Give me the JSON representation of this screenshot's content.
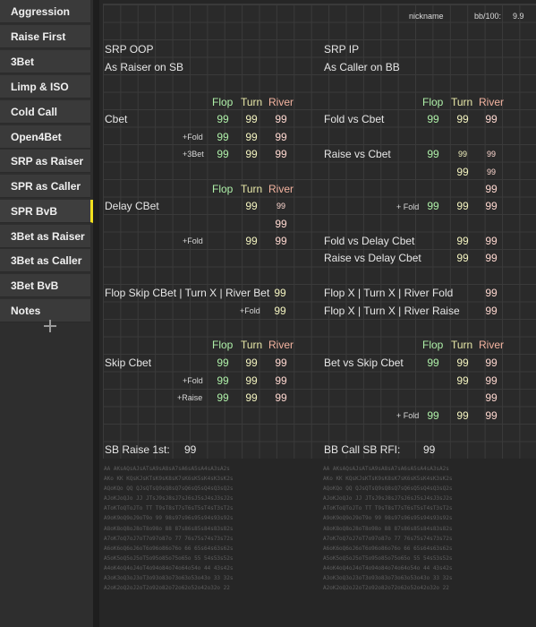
{
  "sidebar": {
    "items": [
      {
        "label": "Aggression"
      },
      {
        "label": "Raise First"
      },
      {
        "label": "3Bet"
      },
      {
        "label": "Limp & ISO"
      },
      {
        "label": "Cold Call"
      },
      {
        "label": "Open4Bet"
      },
      {
        "label": "SRP as Raiser"
      },
      {
        "label": "SPR as Caller"
      },
      {
        "label": "SPR BvB"
      },
      {
        "label": "3Bet as Raiser"
      },
      {
        "label": "3Bet as Caller"
      },
      {
        "label": "3Bet BvB"
      },
      {
        "label": "Notes"
      }
    ],
    "active_index": 8,
    "accent_color": "#f2e01e",
    "add_icon": "plus-icon"
  },
  "header": {
    "nickname_label": "nickname",
    "bb100_label": "bb/100:",
    "bb100_value": "9.9"
  },
  "left": {
    "title": "SRP OOP",
    "subtitle": "As Raiser on SB",
    "col_flop": "Flop",
    "col_turn": "Turn",
    "col_river": "River",
    "cbet": {
      "label": "Cbet",
      "flop": "99",
      "turn": "99",
      "river": "99"
    },
    "cbet_fold": {
      "label": "+Fold",
      "flop": "99",
      "turn": "99",
      "river": "99"
    },
    "cbet_3bet": {
      "label": "+3Bet",
      "flop": "99",
      "turn": "99",
      "river": "99"
    },
    "delay_cbet": {
      "label": "Delay CBet",
      "turn": "99",
      "river": "99",
      "river2": "99"
    },
    "delay_fold": {
      "label": "+Fold",
      "turn": "99",
      "river": "99"
    },
    "flop_skip": {
      "label": "Flop Skip CBet | Turn X | River Bet",
      "river": "99"
    },
    "flop_skip_fold": {
      "label": "+Fold",
      "river": "99"
    },
    "skip_cbet": {
      "label": "Skip Cbet",
      "flop": "99",
      "turn": "99",
      "river": "99"
    },
    "skip_fold": {
      "label": "+Fold",
      "flop": "99",
      "turn": "99",
      "river": "99"
    },
    "skip_raise": {
      "label": "+Raise",
      "flop": "99",
      "turn": "99",
      "river": "99"
    },
    "footer_label": "SB Raise 1st:",
    "footer_value": "99"
  },
  "right": {
    "title": "SRP IP",
    "subtitle": "As Caller on BB",
    "col_flop": "Flop",
    "col_turn": "Turn",
    "col_river": "River",
    "fold_vs_cbet": {
      "label": "Fold vs Cbet",
      "flop": "99",
      "turn": "99",
      "river": "99"
    },
    "raise_vs_cbet": {
      "label": "Raise vs Cbet",
      "flop": "99",
      "turn": "99",
      "river": "99",
      "turn2": "99",
      "river2": "99"
    },
    "delay_fold_row": {
      "river": "99"
    },
    "delay_plus_fold": {
      "label": "+ Fold",
      "flop": "99",
      "turn": "99",
      "river": "99"
    },
    "fold_vs_delay": {
      "label": "Fold vs Delay Cbet",
      "turn": "99",
      "river": "99"
    },
    "raise_vs_delay": {
      "label": "Raise vs Delay Cbet",
      "turn": "99",
      "river": "99"
    },
    "flop_x_fold": {
      "label": "Flop X | Turn X | River Fold",
      "river": "99"
    },
    "flop_x_raise": {
      "label": "Flop X | Turn X | River Raise",
      "river": "99"
    },
    "bet_vs_skip": {
      "label": "Bet vs Skip Cbet",
      "flop": "99",
      "turn": "99",
      "river": "99"
    },
    "bet_vs_skip_r2": {
      "turn": "99",
      "river": "99"
    },
    "bet_vs_skip_r3": {
      "river": "99"
    },
    "bet_plus_fold": {
      "label": "+ Fold",
      "flop": "99",
      "turn": "99",
      "river": "99"
    },
    "footer_label": "BB Call SB RFI:",
    "footer_value": "99"
  },
  "ranges": {
    "left": "AA AKsAQsAJsATsA9sA8sA7sA6sA5sA4sA3sA2s\nAKo KK KQsKJsKTsK9sK8sK7sK6sK5sK4sK3sK2s\nAQoKQo QQ QJsQTsQ9sQ8sQ7sQ6sQ5sQ4sQ3sQ2s\nAJoKJoQJo JJ JTsJ9sJ8sJ7sJ6sJ5sJ4sJ3sJ2s\nAToKToQToJTo TT T9sT8sT7sT6sT5sT4sT3sT2s\nA9oK9oQ9oJ9oT9o 99 98s97s96s95s94s93s92s\nA8oK8oQ8oJ8oT8o98o 88 87s86s85s84s83s82s\nA7oK7oQ7oJ7oT7o97o87o 77 76s75s74s73s72s\nA6oK6oQ6oJ6oT6o96o86o76o 66 65s64s63s62s\nA5oK5oQ5oJ5oT5o95o85o75o65o 55 54s53s52s\nA4oK4oQ4oJ4oT4o94o84o74o64o54o 44 43s42s\nA3oK3oQ3oJ3oT3o93o83o73o63o53o43o 33 32s\nA2oK2oQ2oJ2oT2o92o82o72o62o52o42o32o 22",
    "right": "AA AKsAQsAJsATsA9sA8sA7sA6sA5sA4sA3sA2s\nAKo KK KQsKJsKTsK9sK8sK7sK6sK5sK4sK3sK2s\nAQoKQo QQ QJsQTsQ9sQ8sQ7sQ6sQ5sQ4sQ3sQ2s\nAJoKJoQJo JJ JTsJ9sJ8sJ7sJ6sJ5sJ4sJ3sJ2s\nAToKToQToJTo TT T9sT8sT7sT6sT5sT4sT3sT2s\nA9oK9oQ9oJ9oT9o 99 98s97s96s95s94s93s92s\nA8oK8oQ8oJ8oT8o98o 88 87s86s85s84s83s82s\nA7oK7oQ7oJ7oT7o97o87o 77 76s75s74s73s72s\nA6oK6oQ6oJ6oT6o96o86o76o 66 65s64s63s62s\nA5oK5oQ5oJ5oT5o95o85o75o65o 55 54s53s52s\nA4oK4oQ4oJ4oT4o94o84o74o64o54o 44 43s42s\nA3oK3oQ3oJ3oT3o93o83o73o63o53o43o 33 32s\nA2oK2oQ2oJ2oT2o92o82o72o62o52o42o32o 22"
  }
}
